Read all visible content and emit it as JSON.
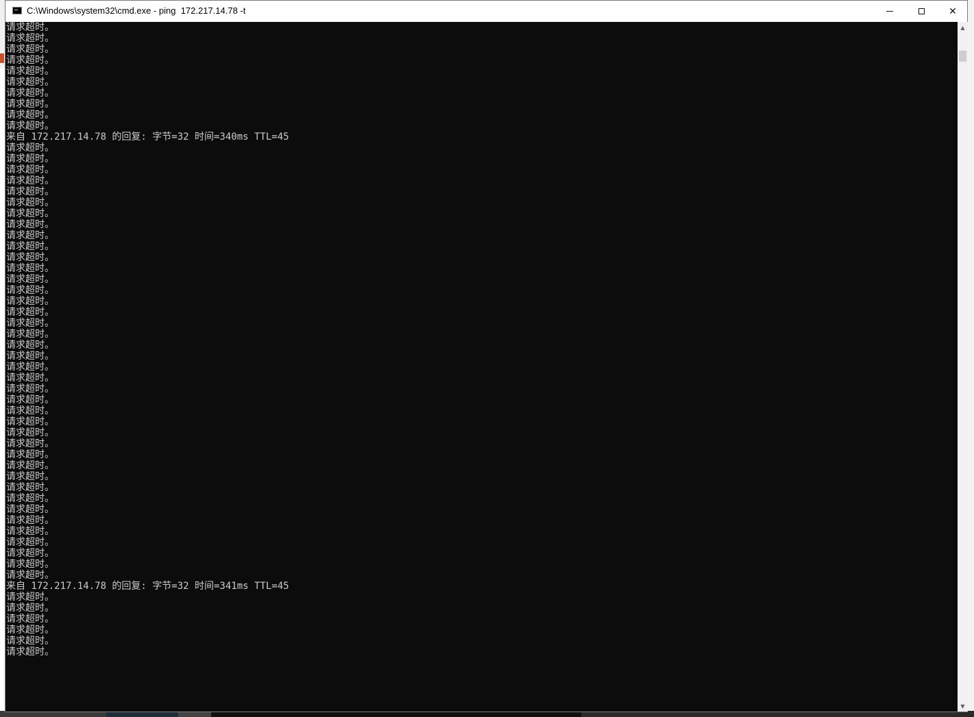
{
  "window": {
    "title": "C:\\Windows\\system32\\cmd.exe - ping  172.217.14.78 -t",
    "icon": "cmd-icon",
    "controls": {
      "minimize_icon": "minimize-icon",
      "maximize_icon": "maximize-icon",
      "close_label": "✕"
    }
  },
  "console": {
    "text_color": "#cccccc",
    "background": "#0c0c0c",
    "lines": [
      "请求超时。",
      "请求超时。",
      "请求超时。",
      "请求超时。",
      "请求超时。",
      "请求超时。",
      "请求超时。",
      "请求超时。",
      "请求超时。",
      "请求超时。",
      "来自 172.217.14.78 的回复: 字节=32 时间=340ms TTL=45",
      "请求超时。",
      "请求超时。",
      "请求超时。",
      "请求超时。",
      "请求超时。",
      "请求超时。",
      "请求超时。",
      "请求超时。",
      "请求超时。",
      "请求超时。",
      "请求超时。",
      "请求超时。",
      "请求超时。",
      "请求超时。",
      "请求超时。",
      "请求超时。",
      "请求超时。",
      "请求超时。",
      "请求超时。",
      "请求超时。",
      "请求超时。",
      "请求超时。",
      "请求超时。",
      "请求超时。",
      "请求超时。",
      "请求超时。",
      "请求超时。",
      "请求超时。",
      "请求超时。",
      "请求超时。",
      "请求超时。",
      "请求超时。",
      "请求超时。",
      "请求超时。",
      "请求超时。",
      "请求超时。",
      "请求超时。",
      "请求超时。",
      "请求超时。",
      "请求超时。",
      "来自 172.217.14.78 的回复: 字节=32 时间=341ms TTL=45",
      "请求超时。",
      "请求超时。",
      "请求超时。",
      "请求超时。",
      "请求超时。",
      "请求超时。"
    ]
  },
  "scrollbar": {
    "up_icon": "▲",
    "down_icon": "▼"
  }
}
